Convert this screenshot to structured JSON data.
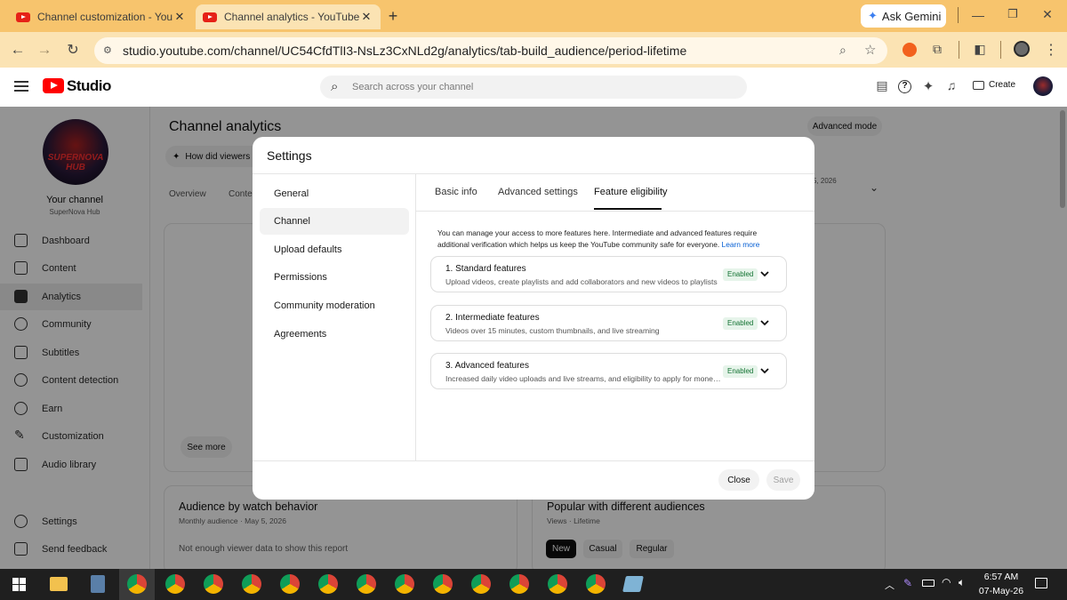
{
  "browser": {
    "tabs": [
      {
        "title": "Channel customization - YouTu"
      },
      {
        "title": "Channel analytics - YouTube St"
      }
    ],
    "new_tab": "+",
    "ask_gemini": "Ask Gemini",
    "url": "studio.youtube.com/channel/UC54CfdTlI3-NsLz3CxNLd2g/analytics/tab-build_audience/period-lifetime"
  },
  "studio": {
    "logo_text": "Studio",
    "search_placeholder": "Search across your channel",
    "create_label": "Create"
  },
  "sidebar": {
    "avatar_text": "SUPERNOVA HUB",
    "your_channel": "Your channel",
    "channel_name": "SuperNova Hub",
    "items": [
      {
        "label": "Dashboard"
      },
      {
        "label": "Content"
      },
      {
        "label": "Analytics"
      },
      {
        "label": "Community"
      },
      {
        "label": "Subtitles"
      },
      {
        "label": "Content detection"
      },
      {
        "label": "Earn"
      },
      {
        "label": "Customization"
      },
      {
        "label": "Audio library"
      }
    ],
    "settings": "Settings",
    "send_feedback": "Send feedback"
  },
  "page": {
    "title": "Channel analytics",
    "advanced_mode": "Advanced mode",
    "chip": "How did viewers f",
    "tabs": [
      "Overview",
      "Conte"
    ],
    "date_fragment": "5, 2026",
    "see_more": "See more",
    "audience_card": {
      "title": "Audience by watch behavior",
      "subtitle": "Monthly audience · May 5, 2026",
      "empty": "Not enough viewer data to show this report"
    },
    "popular_card": {
      "title": "Popular with different audiences",
      "subtitle": "Views · Lifetime",
      "pills": [
        "New",
        "Casual",
        "Regular"
      ]
    }
  },
  "dialog": {
    "title": "Settings",
    "nav": [
      {
        "label": "General"
      },
      {
        "label": "Channel"
      },
      {
        "label": "Upload defaults"
      },
      {
        "label": "Permissions"
      },
      {
        "label": "Community moderation"
      },
      {
        "label": "Agreements"
      }
    ],
    "tabs": [
      "Basic info",
      "Advanced settings",
      "Feature eligibility"
    ],
    "intro": "You can manage your access to more features here. Intermediate and advanced features require additional verification which helps us keep the YouTube community safe for everyone.",
    "learn_more": "Learn more",
    "features": [
      {
        "title": "1. Standard features",
        "desc": "Upload videos, create playlists and add collaborators and new videos to playlists",
        "status": "Enabled"
      },
      {
        "title": "2. Intermediate features",
        "desc": "Videos over 15 minutes, custom thumbnails, and live streaming",
        "status": "Enabled"
      },
      {
        "title": "3. Advanced features",
        "desc": "Increased daily video uploads and live streams, and eligibility to apply for moneti...",
        "status": "Enabled"
      }
    ],
    "close": "Close",
    "save": "Save"
  },
  "taskbar": {
    "time": "6:57 AM",
    "date": "07-May-26"
  },
  "colors": {
    "youtube_red": "#ff0000",
    "chrome_frame": "#f7c46d",
    "enabled_bg": "#e6f4ea",
    "enabled_text": "#137333",
    "link": "#065fd4"
  }
}
